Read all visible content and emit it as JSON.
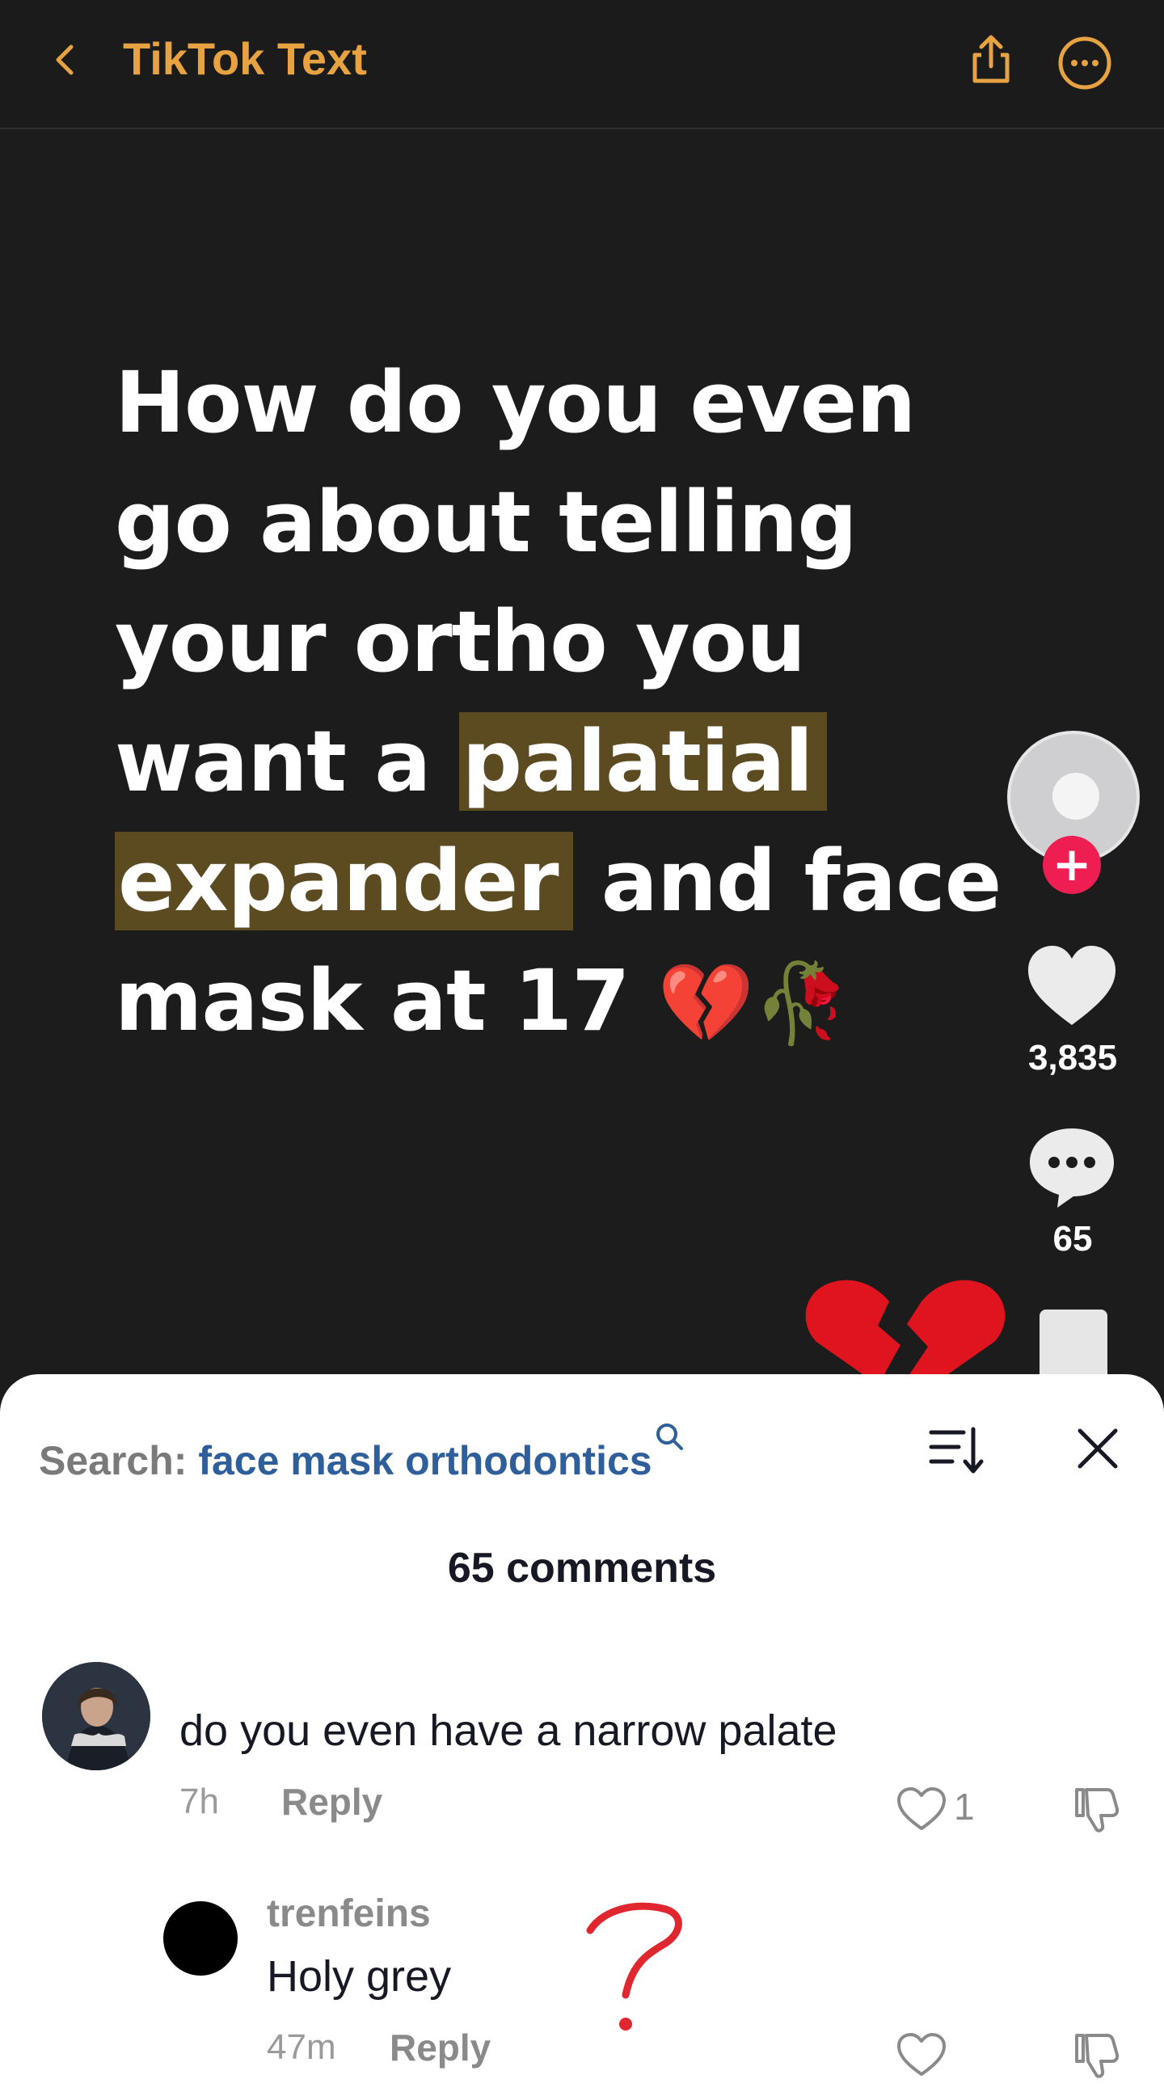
{
  "header": {
    "title": "TikTok Text"
  },
  "video": {
    "caption_lines": [
      [
        "How do you even"
      ],
      [
        "go about telling"
      ],
      [
        "your ortho you"
      ],
      [
        "want a ",
        "palatial"
      ],
      [
        "expander",
        " and face"
      ],
      [
        "mask at 17 ",
        "💔🥀"
      ]
    ],
    "caption_part1": "How do you even go about telling your ortho you want a ",
    "caption_hl1": "palatial",
    "caption_hl2": "expander",
    "caption_part2": " and face mask at 17 ",
    "caption_emoji": "💔🥀",
    "likes": "3,835",
    "comments": "65"
  },
  "comments_panel": {
    "search_label": "Search: ",
    "search_term": "face mask orthodontics",
    "count_label": "65 comments",
    "comments": [
      {
        "text": "do you even have a narrow palate",
        "time": "7h",
        "reply_label": "Reply",
        "likes": "1"
      }
    ],
    "replies": [
      {
        "username": "trenfeins",
        "text": "Holy grey",
        "time": "47m",
        "reply_label": "Reply"
      }
    ]
  },
  "colors": {
    "accent": "#e7a341",
    "highlight": "#5c4a20",
    "search_term": "#2f5f9a",
    "follow": "#ee1d52",
    "annotation": "#e0262e"
  }
}
